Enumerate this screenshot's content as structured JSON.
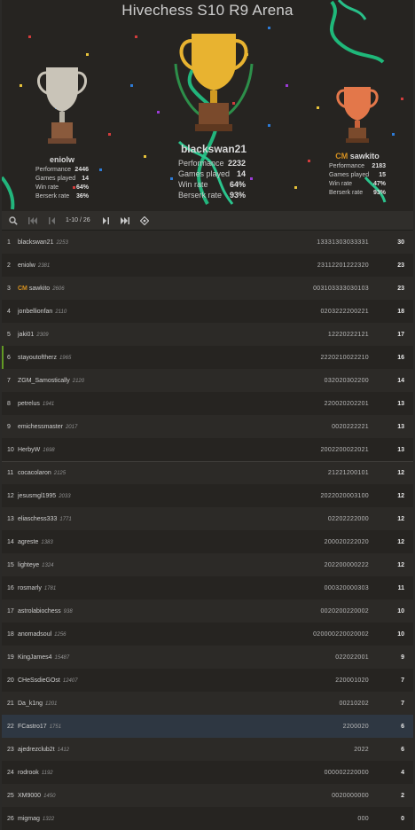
{
  "title": "Hivechess S10 R9 Arena",
  "podium": {
    "first": {
      "name": "blackswan21",
      "stats": [
        {
          "label": "Performance",
          "value": "2232"
        },
        {
          "label": "Games played",
          "value": "14"
        },
        {
          "label": "Win rate",
          "value": "64%"
        },
        {
          "label": "Berserk rate",
          "value": "93%"
        }
      ]
    },
    "second": {
      "name": "eniolw",
      "stats": [
        {
          "label": "Performance",
          "value": "2446"
        },
        {
          "label": "Games played",
          "value": "14"
        },
        {
          "label": "Win rate",
          "value": "64%"
        },
        {
          "label": "Berserk rate",
          "value": "36%"
        }
      ]
    },
    "third": {
      "title": "CM",
      "name": "sawkito",
      "stats": [
        {
          "label": "Performance",
          "value": "2183"
        },
        {
          "label": "Games played",
          "value": "15"
        },
        {
          "label": "Win rate",
          "value": "47%"
        },
        {
          "label": "Berserk rate",
          "value": "93%"
        }
      ]
    }
  },
  "pager": {
    "range": "1-10 / 26"
  },
  "players": [
    {
      "rank": "1",
      "title": "",
      "name": "blackswan21",
      "rating": "2253",
      "sheet": "13331303033331",
      "score": "30"
    },
    {
      "rank": "2",
      "title": "",
      "name": "eniolw",
      "rating": "2381",
      "sheet": "23112201222320",
      "score": "23"
    },
    {
      "rank": "3",
      "title": "CM",
      "name": "sawkito",
      "rating": "2606",
      "sheet": "003103333030103",
      "score": "23"
    },
    {
      "rank": "4",
      "title": "",
      "name": "jonbellionfan",
      "rating": "2110",
      "sheet": "0203222200221",
      "score": "18"
    },
    {
      "rank": "5",
      "title": "",
      "name": "jaki01",
      "rating": "2309",
      "sheet": "12220222121",
      "score": "17"
    },
    {
      "rank": "6",
      "title": "",
      "name": "stayoutoftherz",
      "rating": "1965",
      "sheet": "2220210022210",
      "score": "16"
    },
    {
      "rank": "7",
      "title": "",
      "name": "ZGM_Samostically",
      "rating": "2120",
      "sheet": "032020302200",
      "score": "14"
    },
    {
      "rank": "8",
      "title": "",
      "name": "petrelus",
      "rating": "1941",
      "sheet": "220020202201",
      "score": "13"
    },
    {
      "rank": "9",
      "title": "",
      "name": "emichessmaster",
      "rating": "2017",
      "sheet": "0020222221",
      "score": "13"
    },
    {
      "rank": "10",
      "title": "",
      "name": "HerbyW",
      "rating": "1698",
      "sheet": "2002200022021",
      "score": "13"
    },
    {
      "rank": "11",
      "title": "",
      "name": "cocacolaron",
      "rating": "2125",
      "sheet": "21221200101",
      "score": "12"
    },
    {
      "rank": "12",
      "title": "",
      "name": "jesusmgl1995",
      "rating": "2033",
      "sheet": "2022020003100",
      "score": "12"
    },
    {
      "rank": "13",
      "title": "",
      "name": "eliaschess333",
      "rating": "1771",
      "sheet": "02202222000",
      "score": "12"
    },
    {
      "rank": "14",
      "title": "",
      "name": "agreste",
      "rating": "1383",
      "sheet": "200020222020",
      "score": "12"
    },
    {
      "rank": "15",
      "title": "",
      "name": "lighteye",
      "rating": "1324",
      "sheet": "202200000222",
      "score": "12"
    },
    {
      "rank": "16",
      "title": "",
      "name": "rosmarly",
      "rating": "1781",
      "sheet": "000320000303",
      "score": "11"
    },
    {
      "rank": "17",
      "title": "",
      "name": "astrolabiochess",
      "rating": "938",
      "sheet": "0020200220002",
      "score": "10"
    },
    {
      "rank": "18",
      "title": "",
      "name": "anomadsoul",
      "rating": "1256",
      "sheet": "020000220020002",
      "score": "10"
    },
    {
      "rank": "19",
      "title": "",
      "name": "KingJames4",
      "rating": "15487",
      "sheet": "022022001",
      "score": "9"
    },
    {
      "rank": "20",
      "title": "",
      "name": "CHeSsdieGOst",
      "rating": "12407",
      "sheet": "220001020",
      "score": "7"
    },
    {
      "rank": "21",
      "title": "",
      "name": "Da_k1ng",
      "rating": "1201",
      "sheet": "00210202",
      "score": "7"
    },
    {
      "rank": "22",
      "title": "",
      "name": "FCastro17",
      "rating": "1751",
      "sheet": "2200020",
      "score": "6"
    },
    {
      "rank": "23",
      "title": "",
      "name": "ajedrezclub2t",
      "rating": "1412",
      "sheet": "2022",
      "score": "6"
    },
    {
      "rank": "24",
      "title": "",
      "name": "rodrook",
      "rating": "1192",
      "sheet": "000002220000",
      "score": "4"
    },
    {
      "rank": "25",
      "title": "",
      "name": "XM9000",
      "rating": "1450",
      "sheet": "0020000000",
      "score": "2"
    },
    {
      "rank": "26",
      "title": "",
      "name": "migmag",
      "rating": "1322",
      "sheet": "000",
      "score": "0"
    }
  ],
  "colors": {
    "accent_green": "#629924",
    "title_orange": "#d59020",
    "gold": "#e8b330",
    "silver": "#c9c4b8",
    "bronze": "#e3774a"
  },
  "icons": [
    "search-icon",
    "first-page-icon",
    "prev-page-icon",
    "next-page-icon",
    "last-page-icon",
    "locate-me-icon"
  ]
}
